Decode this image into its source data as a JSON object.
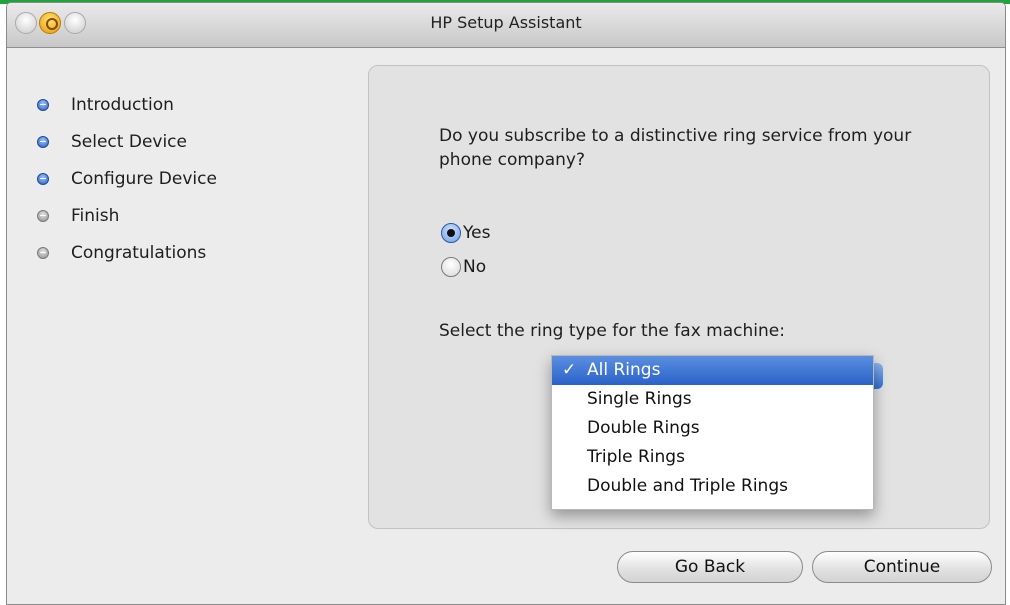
{
  "window": {
    "title": "HP Setup Assistant"
  },
  "sidebar": {
    "steps": [
      {
        "label": "Introduction",
        "state": "done"
      },
      {
        "label": "Select Device",
        "state": "done"
      },
      {
        "label": "Configure Device",
        "state": "current"
      },
      {
        "label": "Finish",
        "state": "pending"
      },
      {
        "label": "Congratulations",
        "state": "pending"
      }
    ]
  },
  "main": {
    "question": "Do you subscribe to a distinctive ring service from your phone company?",
    "options": [
      {
        "label": "Yes",
        "selected": true
      },
      {
        "label": "No",
        "selected": false
      }
    ],
    "ring_type_label": "Select the ring type for the fax machine:",
    "ring_menu": {
      "items": [
        "All Rings",
        "Single Rings",
        "Double Rings",
        "Triple Rings",
        "Double and Triple Rings"
      ],
      "selected_index": 0,
      "check_glyph": "✓"
    }
  },
  "buttons": {
    "back": "Go Back",
    "continue": "Continue"
  },
  "colors": {
    "active_step": "#2a5db8",
    "inactive_step": "#8d8d8d",
    "menu_highlight": "#2a62c9"
  }
}
